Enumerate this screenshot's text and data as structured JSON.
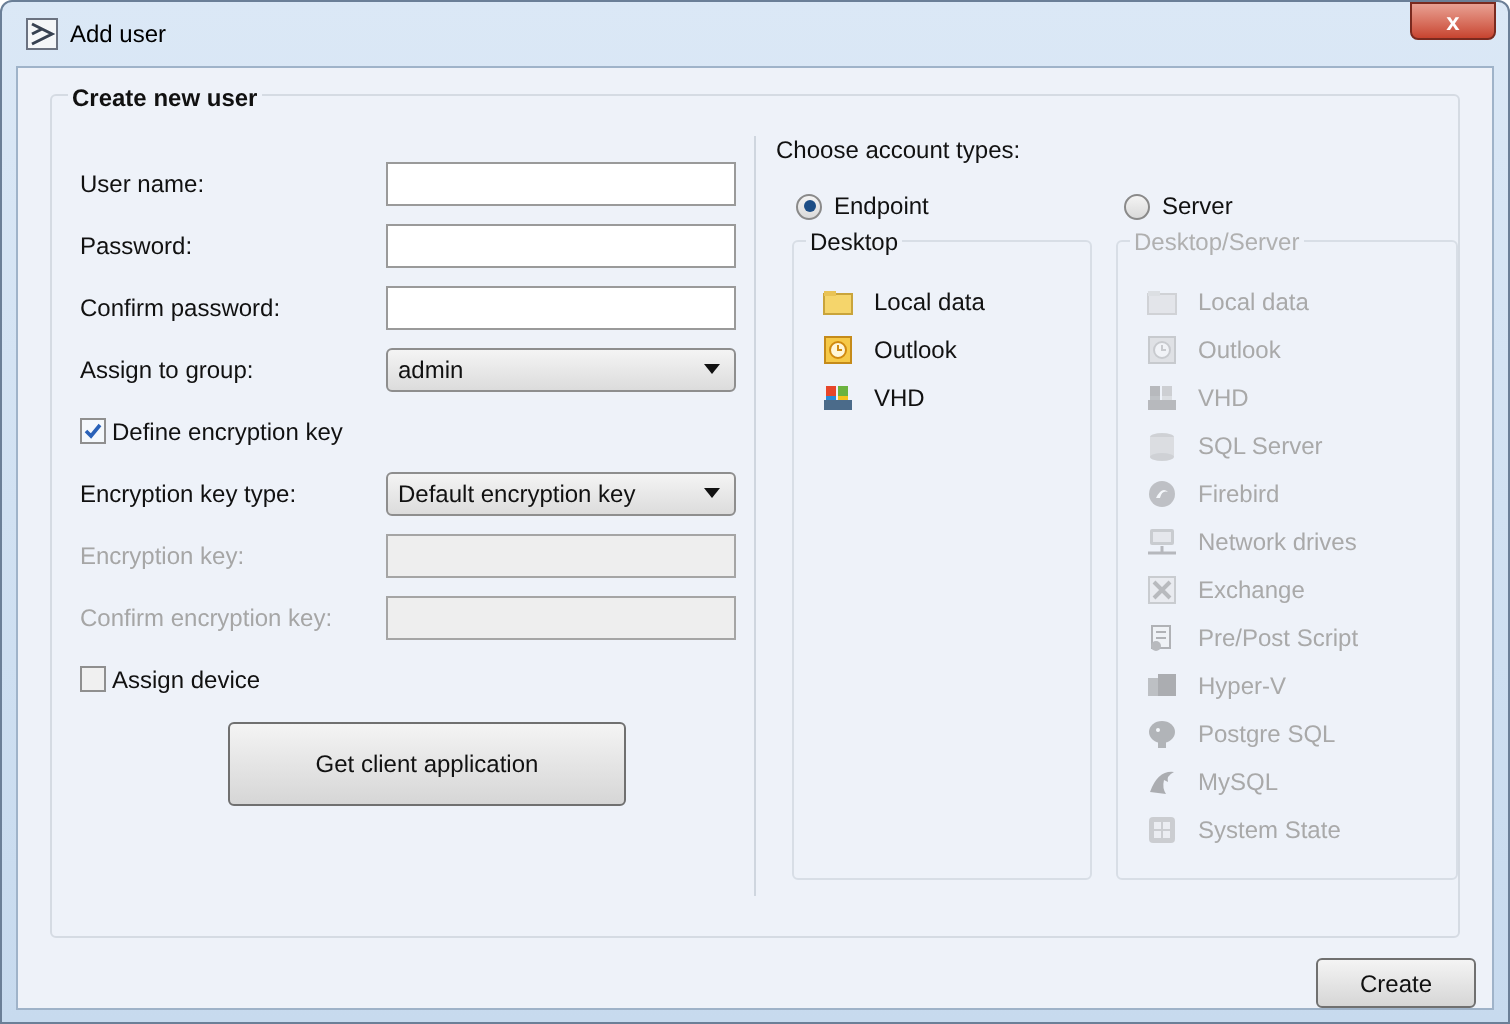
{
  "window": {
    "title": "Add user",
    "close": "x"
  },
  "group": {
    "title": "Create new user",
    "rows": [
      {
        "kind": "text",
        "label": "User name:",
        "disabled": false
      },
      {
        "kind": "text",
        "label": "Password:",
        "disabled": false
      },
      {
        "kind": "text",
        "label": "Confirm password:",
        "disabled": false
      },
      {
        "kind": "select",
        "label": "Assign to group:",
        "value": "admin",
        "disabled": false
      },
      {
        "kind": "checkbox",
        "label": "Define encryption key",
        "checked": true
      },
      {
        "kind": "select",
        "label": "Encryption key type:",
        "value": "Default encryption key",
        "disabled": false
      },
      {
        "kind": "text",
        "label": "Encryption key:",
        "disabled": true
      },
      {
        "kind": "text",
        "label": "Confirm encryption key:",
        "disabled": true
      },
      {
        "kind": "checkbox",
        "label": "Assign device",
        "checked": false
      }
    ],
    "action": "Get client application"
  },
  "account_types": {
    "title": "Choose account types:",
    "options": [
      {
        "label": "Endpoint",
        "selected": true,
        "group": {
          "title": "Desktop",
          "disabled": false,
          "items": [
            "Local data",
            "Outlook",
            "VHD"
          ]
        }
      },
      {
        "label": "Server",
        "selected": false,
        "group": {
          "title": "Desktop/Server",
          "disabled": true,
          "items": [
            "Local data",
            "Outlook",
            "VHD",
            "SQL Server",
            "Firebird",
            "Network drives",
            "Exchange",
            "Pre/Post Script",
            "Hyper-V",
            "Postgre SQL",
            "MySQL",
            "System State"
          ]
        }
      }
    ]
  },
  "buttons": [
    "Create"
  ]
}
